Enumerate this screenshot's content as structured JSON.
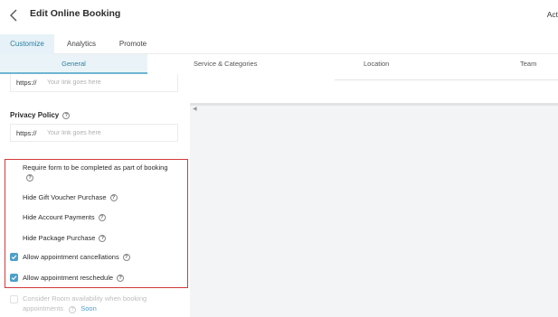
{
  "header": {
    "title": "Edit Online Booking",
    "right_label": "Act"
  },
  "tabs": [
    {
      "label": "Customize",
      "active": true
    },
    {
      "label": "Analytics",
      "active": false
    },
    {
      "label": "Promote",
      "active": false
    }
  ],
  "subtabs": [
    {
      "label": "General",
      "active": true
    },
    {
      "label": "Service & Categories",
      "active": false
    },
    {
      "label": "Location",
      "active": false
    },
    {
      "label": "Team",
      "active": false
    }
  ],
  "booking_link": {
    "prefix": "https://",
    "placeholder": "Your link goes here"
  },
  "privacy_policy": {
    "label": "Privacy Policy",
    "prefix": "https://",
    "placeholder": "Your link goes here"
  },
  "options": {
    "require_form": {
      "label": "Require form to be completed as part of booking",
      "checked": false
    },
    "hide_gift_voucher": {
      "label": "Hide Gift Voucher Purchase",
      "checked": false
    },
    "hide_account_payments": {
      "label": "Hide Account Payments",
      "checked": false
    },
    "hide_package_purchase": {
      "label": "Hide Package Purchase",
      "checked": false
    },
    "allow_cancellations": {
      "label": "Allow appointment cancellations",
      "checked": true
    },
    "allow_reschedule": {
      "label": "Allow appointment reschedule",
      "checked": true
    },
    "consider_room": {
      "label": "Consider Room availability when booking appointments",
      "badge": "Soon",
      "disabled": true
    }
  },
  "colors": {
    "accent": "#4d9fc9",
    "highlight_border": "#d33a3a",
    "active_tab_bg": "#e6f2f7"
  },
  "icons": {
    "back": "chevron-left-icon",
    "help": "help-circle-icon",
    "check": "check-icon"
  }
}
